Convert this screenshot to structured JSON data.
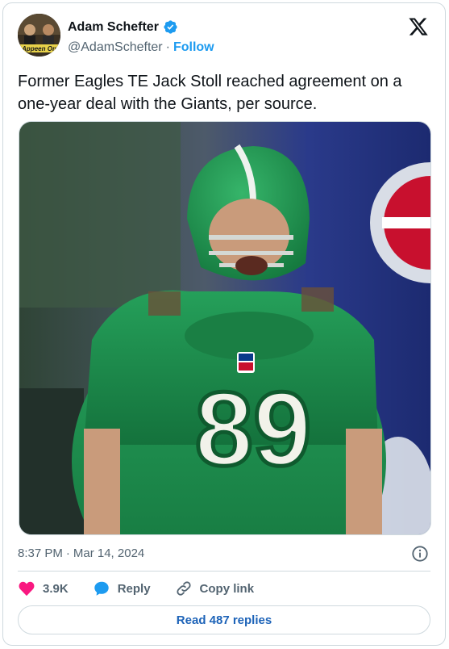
{
  "author": {
    "display_name": "Adam Schefter",
    "handle": "@AdamSchefter",
    "separator": "·",
    "follow_label": "Follow",
    "avatar_text": "Appeen On"
  },
  "tweet": {
    "text": "Former Eagles TE Jack Stoll reached agreement on a one-year deal with the Giants, per source.",
    "time": "8:37 PM",
    "separator": "·",
    "date": "Mar 14, 2024"
  },
  "media": {
    "jersey_number": "89"
  },
  "actions": {
    "likes_count": "3.9K",
    "reply_label": "Reply",
    "copy_link_label": "Copy link"
  },
  "replies": {
    "label": "Read 487 replies"
  },
  "colors": {
    "accent": "#1d9bf0",
    "like": "#f91880",
    "reply": "#1d9bf0",
    "read_replies": "#1d63b8",
    "jersey_green": "#1e8a4c"
  }
}
